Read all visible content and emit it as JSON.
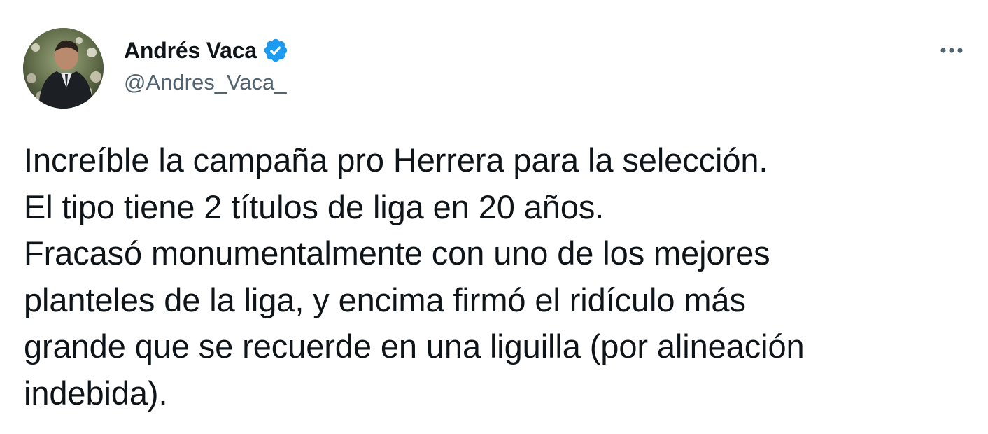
{
  "author": {
    "display_name": "Andrés Vaca",
    "handle": "@Andres_Vaca_",
    "verified": true
  },
  "icons": {
    "verified": "verified-badge-icon",
    "more": "more-options-icon"
  },
  "tweet": {
    "lines": [
      "Increíble la campaña pro Herrera para la selección.",
      "El tipo tiene 2 títulos de liga en 20 años.",
      "Fracasó monumentalmente con uno de los mejores",
      "planteles de la liga, y encima firmó el ridículo más",
      "grande que se recuerde en una liguilla (por alineación",
      "indebida)."
    ]
  },
  "colors": {
    "verified_blue": "#1d9bf0",
    "text_primary": "#0f1419",
    "text_secondary": "#536471"
  }
}
